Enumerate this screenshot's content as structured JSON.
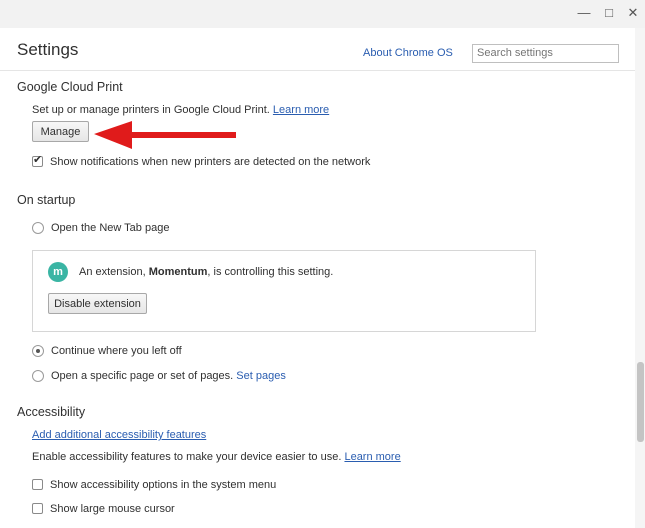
{
  "window": {
    "minimize_glyph": "—",
    "maximize_glyph": "□",
    "close_glyph": "✕"
  },
  "header": {
    "title": "Settings",
    "about_link": "About Chrome OS",
    "search_placeholder": "Search settings"
  },
  "cloud_print": {
    "title": "Google Cloud Print",
    "description": "Set up or manage printers in Google Cloud Print.",
    "learn_more": "Learn more",
    "manage_button": "Manage",
    "notifications_label": "Show notifications when new printers are detected on the network",
    "notifications_checked": true
  },
  "startup": {
    "title": "On startup",
    "option_new_tab": "Open the New Tab page",
    "extension_notice": {
      "icon_letter": "m",
      "text_before": "An extension, ",
      "extension_name": "Momentum",
      "text_after": ", is controlling this setting.",
      "disable_button": "Disable extension",
      "icon_color": "#3ab5a4"
    },
    "option_continue": "Continue where you left off",
    "option_specific": "Open a specific page or set of pages.",
    "set_pages_link": "Set pages",
    "selected": "Continue where you left off"
  },
  "accessibility": {
    "title": "Accessibility",
    "add_features_link": "Add additional accessibility features",
    "description": "Enable accessibility features to make your device easier to use.",
    "learn_more": "Learn more",
    "option_system_menu": "Show accessibility options in the system menu",
    "option_large_cursor": "Show large mouse cursor"
  },
  "colors": {
    "link": "#2a5db0",
    "arrow": "#e01b1b"
  }
}
